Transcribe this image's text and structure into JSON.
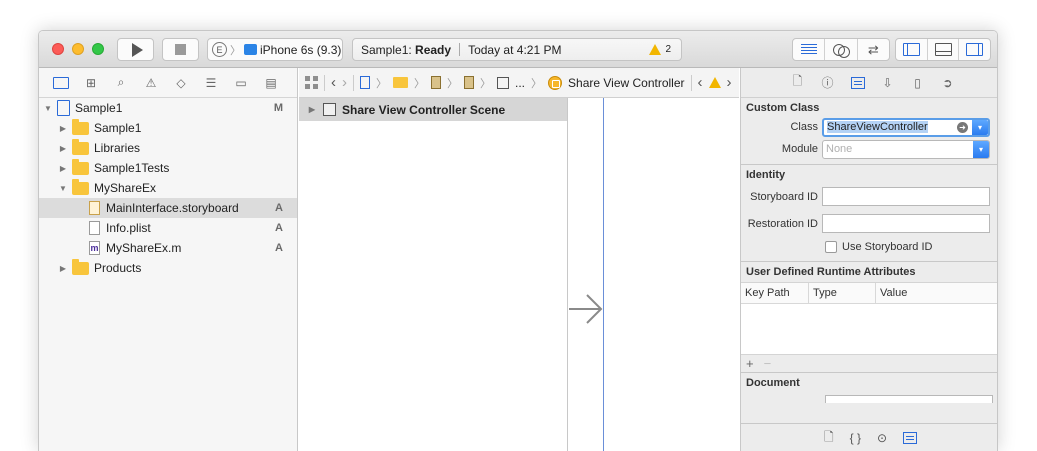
{
  "toolbar": {
    "scheme_badge": "E",
    "scheme_device": "iPhone 6s (9.3)",
    "activity_project": "Sample1:",
    "activity_status": "Ready",
    "activity_time": "Today at 4:21 PM",
    "warning_count": "2",
    "icons": [
      "run-icon",
      "stop-icon",
      "standard-editor-icon",
      "assistant-editor-icon",
      "version-editor-icon",
      "navigator-toggle-icon",
      "debug-area-toggle-icon",
      "utilities-toggle-icon"
    ]
  },
  "navigator": {
    "tabs": [
      "project-navigator-icon",
      "symbol-navigator-icon",
      "find-navigator-icon",
      "issue-navigator-icon",
      "test-navigator-icon",
      "debug-navigator-icon",
      "breakpoint-navigator-icon",
      "report-navigator-icon"
    ],
    "items": [
      {
        "label": "Sample1",
        "status": "M"
      },
      {
        "label": "Sample1",
        "status": ""
      },
      {
        "label": "Libraries",
        "status": ""
      },
      {
        "label": "Sample1Tests",
        "status": ""
      },
      {
        "label": "MyShareEx",
        "status": ""
      },
      {
        "label": "MainInterface.storyboard",
        "status": "A"
      },
      {
        "label": "Info.plist",
        "status": "A"
      },
      {
        "label": "MyShareEx.m",
        "status": "A"
      },
      {
        "label": "Products",
        "status": ""
      }
    ]
  },
  "jumpbar": {
    "ellipsis": "...",
    "current": "Share View Controller"
  },
  "outline": {
    "scene": "Share View Controller Scene"
  },
  "inspector": {
    "custom_class": {
      "title": "Custom Class",
      "class_label": "Class",
      "class_value": "ShareViewController",
      "module_label": "Module",
      "module_placeholder": "None"
    },
    "identity": {
      "title": "Identity",
      "storyboard_id_label": "Storyboard ID",
      "restoration_id_label": "Restoration ID",
      "use_storyboard_id_label": "Use Storyboard ID"
    },
    "runtime_attributes": {
      "title": "User Defined Runtime Attributes",
      "columns": [
        "Key Path",
        "Type",
        "Value"
      ],
      "add": "+",
      "remove": "−"
    },
    "document": {
      "title": "Document"
    }
  },
  "colors": {
    "accent": "#2a6ad8",
    "folder": "#f8c53c",
    "warning": "#f2b600"
  }
}
